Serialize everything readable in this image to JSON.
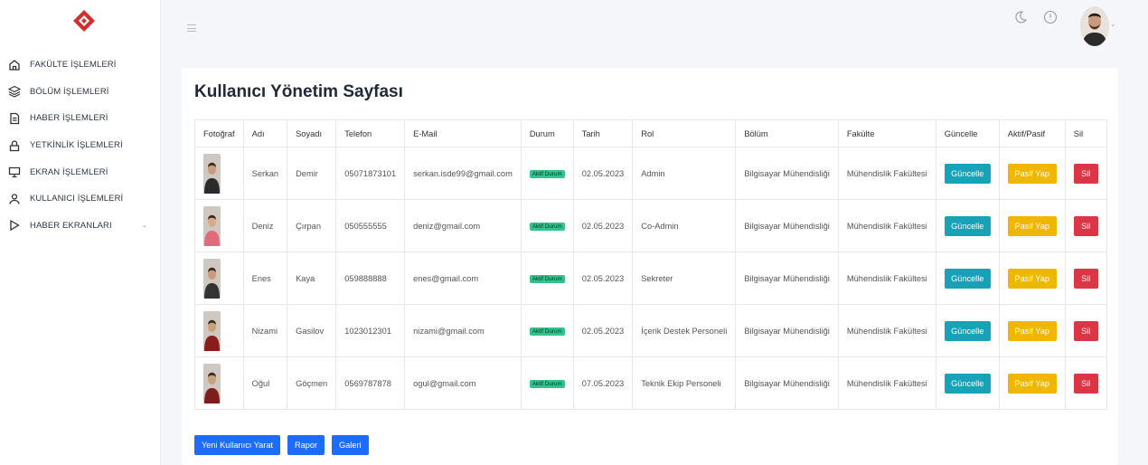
{
  "menu": [
    {
      "label": "FAKÜLTE İŞLEMLERİ",
      "icon": "home-icon"
    },
    {
      "label": "BÖLÜM İŞLEMLERİ",
      "icon": "layers-icon"
    },
    {
      "label": "HABER İŞLEMLERİ",
      "icon": "document-icon"
    },
    {
      "label": "YETKİNLİK İŞLEMLERİ",
      "icon": "lock-icon"
    },
    {
      "label": "EKRAN İŞLEMLERİ",
      "icon": "monitor-icon"
    },
    {
      "label": "KULLANICI İŞLEMLERİ",
      "icon": "user-icon"
    },
    {
      "label": "HABER EKRANLARI",
      "icon": "play-icon"
    }
  ],
  "page_title": "Kullanıcı Yönetim Sayfası",
  "table": {
    "headers": [
      "Fotoğraf",
      "Adı",
      "Soyadı",
      "Telefon",
      "E-Mail",
      "Durum",
      "Tarih",
      "Rol",
      "Bölüm",
      "Fakülte",
      "Güncelle",
      "Aktif/Pasif",
      "Sil"
    ],
    "rows": [
      {
        "ad": "Serkan",
        "soyad": "Demir",
        "telefon": "05071873101",
        "email": "serkan.isde99@gmail.com",
        "durum": "Aktif Durum",
        "tarih": "02.05.2023",
        "rol": "Admin",
        "bolum": "Bilgisayar Mühendisliği",
        "fakulte": "Mühendislik Fakültesi",
        "guncelle": "Güncelle",
        "pasif": "Pasif Yap",
        "sil": "Sil"
      },
      {
        "ad": "Deniz",
        "soyad": "Çırpan",
        "telefon": "050555555",
        "email": "deniz@gmail.com",
        "durum": "Aktif Durum",
        "tarih": "02.05.2023",
        "rol": "Co-Admin",
        "bolum": "Bilgisayar Mühendisliği",
        "fakulte": "Mühendislik Fakültesi",
        "guncelle": "Güncelle",
        "pasif": "Pasif Yap",
        "sil": "Sil"
      },
      {
        "ad": "Enes",
        "soyad": "Kaya",
        "telefon": "059888888",
        "email": "enes@gmail.com",
        "durum": "Aktif Durum",
        "tarih": "02.05.2023",
        "rol": "Sekreter",
        "bolum": "Bilgisayar Mühendisliği",
        "fakulte": "Mühendislik Fakültesi",
        "guncelle": "Güncelle",
        "pasif": "Pasif Yap",
        "sil": "Sil"
      },
      {
        "ad": "Nizami",
        "soyad": "Gasilov",
        "telefon": "1023012301",
        "email": "nizami@gmail.com",
        "durum": "Aktif Durum",
        "tarih": "02.05.2023",
        "rol": "İçerik Destek Personeli",
        "bolum": "Bilgisayar Mühendisliği",
        "fakulte": "Mühendislik Fakültesi",
        "guncelle": "Güncelle",
        "pasif": "Pasif Yap",
        "sil": "Sil"
      },
      {
        "ad": "Oğul",
        "soyad": "Göçmen",
        "telefon": "0569787878",
        "email": "ogul@gmail.com",
        "durum": "Aktif Durum",
        "tarih": "07.05.2023",
        "rol": "Teknik Ekip Personeli",
        "bolum": "Bilgisayar Mühendisliği",
        "fakulte": "Mühendislik Fakültesi",
        "guncelle": "Güncelle",
        "pasif": "Pasif Yap",
        "sil": "Sil"
      }
    ]
  },
  "buttons": {
    "new_user": "Yeni Kullanıcı Yarat",
    "report": "Rapor",
    "gallery": "Galeri"
  },
  "colors": {
    "primary": "#1e6bff",
    "success": "#34c38f",
    "info": "#17a2b8",
    "warning": "#f1b600",
    "danger": "#dc3545",
    "logo": "#d32f2f"
  }
}
